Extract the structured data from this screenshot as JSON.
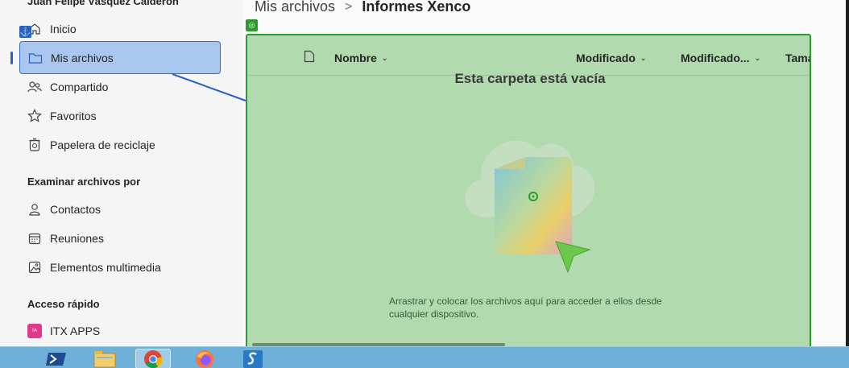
{
  "sidebar": {
    "user_name": "Juan Felipe Vásquez Calderón",
    "items": [
      {
        "label": "Inicio",
        "icon": "home-icon"
      },
      {
        "label": "Mis archivos",
        "icon": "folder-icon"
      },
      {
        "label": "Compartido",
        "icon": "people-icon"
      },
      {
        "label": "Favoritos",
        "icon": "star-icon"
      },
      {
        "label": "Papelera de reciclaje",
        "icon": "recycle-bin-icon"
      }
    ],
    "browse_title": "Examinar archivos por",
    "browse_items": [
      {
        "label": "Contactos",
        "icon": "person-icon"
      },
      {
        "label": "Reuniones",
        "icon": "calendar-icon"
      },
      {
        "label": "Elementos multimedia",
        "icon": "image-icon"
      }
    ],
    "quick_title": "Acceso rápido",
    "quick_items": [
      {
        "label": "ITX APPS",
        "badge": "IA",
        "badge_color": "#e0388c"
      }
    ]
  },
  "breadcrumb": {
    "parent": "Mis archivos",
    "separator": ">",
    "current": "Informes Xenco"
  },
  "columns": {
    "name": "Nombre",
    "modified": "Modificado",
    "modified_by": "Modificado...",
    "size": "Tama"
  },
  "empty_state": {
    "title": "Esta carpeta está vacía",
    "description": "Arrastrar y colocar los archivos aquí para acceder a ellos desde cualquier dispositivo."
  },
  "taskbar": {
    "apps": [
      "powershell-icon",
      "file-explorer-icon",
      "chrome-icon",
      "firefox-icon",
      "app-s-icon"
    ]
  },
  "colors": {
    "selection": "#a9c6ee",
    "accent": "#2a60c4",
    "drop_overlay": "#94cf91",
    "taskbar": "#6fb0d8"
  }
}
